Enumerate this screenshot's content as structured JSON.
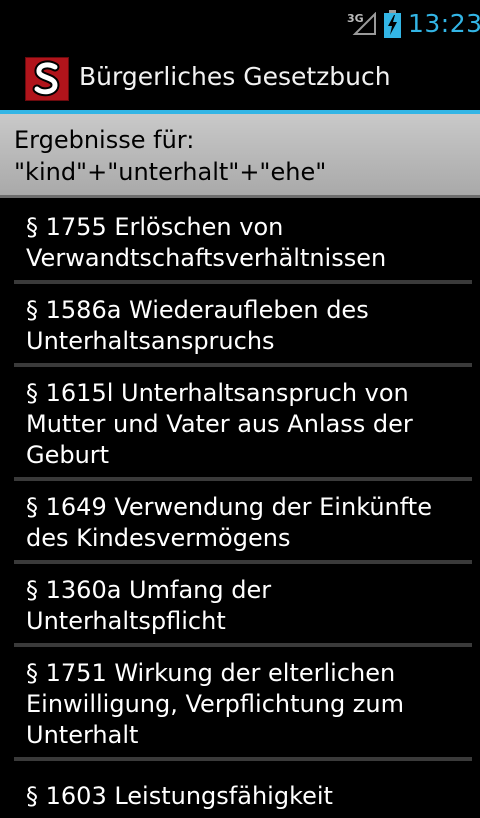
{
  "status_bar": {
    "network": "3G",
    "time": "13:23",
    "accent_color": "#33b5e5"
  },
  "action_bar": {
    "app_icon": "paragraph-logo-icon",
    "title": "Bürgerliches Gesetzbuch"
  },
  "results_header": {
    "line1": "Ergebnisse für:",
    "line2": "\"kind\"+\"unterhalt\"+\"ehe\""
  },
  "results": [
    "§ 1755 Erlöschen von Verwandtschaftsverhältnissen",
    "§ 1586a Wiederaufleben des Unterhaltsanspruchs",
    "§ 1615l Unterhaltsanspruch von Mutter und Vater aus Anlass der Geburt",
    "§ 1649 Verwendung der Einkünfte des Kindesvermögens",
    "§ 1360a Umfang der Unterhaltspflicht",
    "§ 1751 Wirkung der elterlichen Einwilligung, Verpflichtung zum Unterhalt",
    "§ 1603 Leistungsfähigkeit"
  ]
}
